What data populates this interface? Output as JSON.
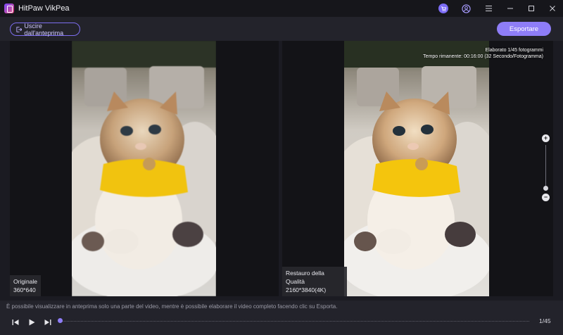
{
  "app": {
    "title": "HitPaw VikPea"
  },
  "toolbar": {
    "exit_label": "Uscire dall'anteprima",
    "export_label": "Esportare"
  },
  "panes": {
    "original": {
      "title": "Originale",
      "resolution": "360*640"
    },
    "restored": {
      "title": "Restauro della Qualità",
      "resolution": "2160*3840(4K)"
    }
  },
  "processing": {
    "processed": "Elaborato 1/45 fotogrammi",
    "remaining": "Tempo rimanente: 00:16:00 (32 Secondo/Fotogramma)"
  },
  "info": {
    "notice": "È possibile visualizzare in anteprima solo una parte del video, mentre è possibile elaborare il video completo facendo clic su Esporta."
  },
  "player": {
    "frame_counter": "1/45",
    "progress": 0.0
  },
  "zoom": {
    "plus": "+",
    "minus": "−",
    "level": 0.1
  },
  "colors": {
    "accent": "#8e7df7",
    "background": "#1b1b22"
  }
}
